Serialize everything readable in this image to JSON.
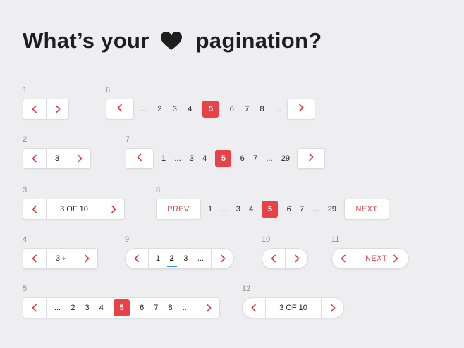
{
  "title": {
    "before": "What’s your",
    "after": "pagination?",
    "icon": "heart-icon"
  },
  "colors": {
    "accent": "#e64248",
    "active_underline": "#3a8ee6",
    "background": "#eeeef1"
  },
  "labels": {
    "n1": "1",
    "n2": "2",
    "n3": "3",
    "n4": "4",
    "n5": "5",
    "n6": "6",
    "n7": "7",
    "n8": "8",
    "n9": "9",
    "n10": "10",
    "n11": "11",
    "n12": "12"
  },
  "ex2": {
    "page": "3"
  },
  "ex3": {
    "status": "3 OF 10"
  },
  "ex4": {
    "page": "3",
    "stepper": "÷"
  },
  "ex5": {
    "pages": [
      "...",
      "2",
      "3",
      "4",
      "5",
      "6",
      "7",
      "8",
      "..."
    ],
    "active": "5"
  },
  "ex6": {
    "pages": [
      "...",
      "2",
      "3",
      "4",
      "5",
      "6",
      "7",
      "8",
      "..."
    ],
    "active": "5"
  },
  "ex7": {
    "pages": [
      "1",
      "...",
      "3",
      "4",
      "5",
      "6",
      "7",
      "...",
      "29"
    ],
    "active": "5"
  },
  "ex8": {
    "prev": "PREV",
    "next": "NEXT",
    "pages": [
      "1",
      "...",
      "3",
      "4",
      "5",
      "6",
      "7",
      "...",
      "29"
    ],
    "active": "5"
  },
  "ex9": {
    "pages": [
      "1",
      "2",
      "3",
      "..."
    ],
    "current": "2"
  },
  "ex11": {
    "next": "NEXT"
  },
  "ex12": {
    "status": "3 OF 10"
  }
}
